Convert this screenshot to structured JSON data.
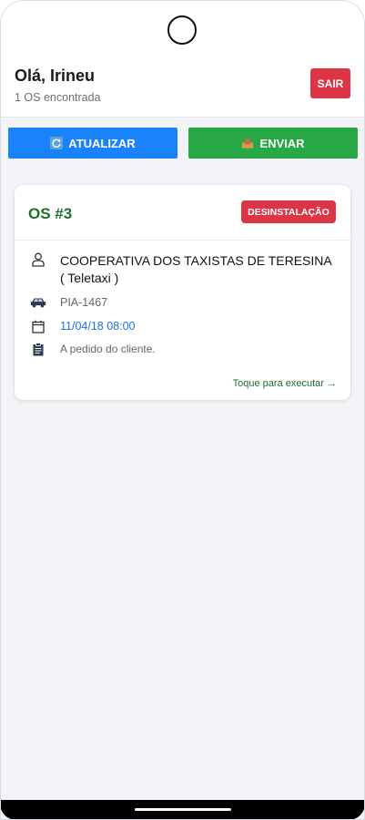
{
  "header": {
    "greeting": "Olá, Irineu",
    "count": "1 OS encontrada",
    "logout_label": "SAIR"
  },
  "actions": {
    "update_label": "ATUALIZAR",
    "send_label": "ENVIAR"
  },
  "orders": [
    {
      "title": "OS #3",
      "type_badge": "DESINSTALAÇÃO",
      "client": "COOPERATIVA DOS TAXISTAS DE TERESINA ( Teletaxi )",
      "plate": "PIA-1467",
      "datetime": "11/04/18 08:00",
      "note": "A pedido do cliente.",
      "action_hint": "Toque para executar →"
    }
  ],
  "icons": {
    "update": "refresh-icon",
    "send": "outbox-tray-icon",
    "client": "user-icon",
    "vehicle": "car-icon",
    "date": "calendar-icon",
    "note": "clipboard-icon"
  },
  "colors": {
    "primary_blue": "#1a82fb",
    "success_green": "#28a745",
    "danger_red": "#dc3545",
    "title_green": "#1f6e2a",
    "link_blue": "#1a73e8"
  }
}
